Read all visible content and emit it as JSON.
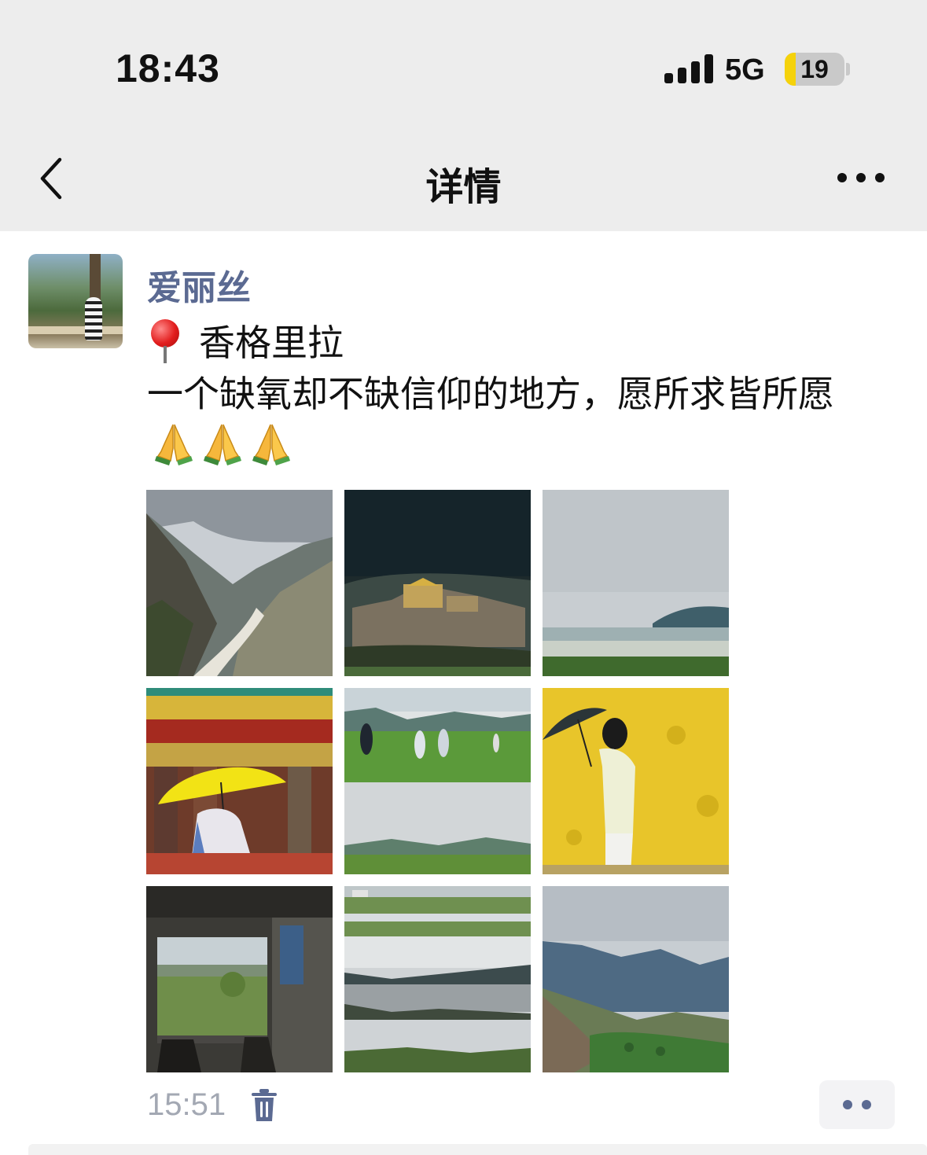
{
  "status_bar": {
    "time": "18:43",
    "network": "5G",
    "battery_level": "19",
    "battery_fraction": 0.19,
    "battery_color": "#f5d20b"
  },
  "nav": {
    "back_icon": "chevron-left-icon",
    "title": "详情",
    "more_icon": "more-horizontal-icon"
  },
  "post": {
    "avatar_icon": "avatar",
    "username": "爱丽丝",
    "location_icon": "round-pushpin-icon",
    "location": "香格里拉",
    "text": "一个缺氧却不缺信仰的地方，愿所求皆所愿",
    "emoji_icons": [
      "folded-hands-icon",
      "folded-hands-icon",
      "folded-hands-icon"
    ],
    "photos": [
      "photo-canyon-river",
      "photo-monastery",
      "photo-lake-grassland",
      "photo-yellow-umbrella-prayer-wheels",
      "photo-grassland-people",
      "photo-yellow-wall-umbrella",
      "photo-window-view",
      "photo-village-lake-collage",
      "photo-mountain-valley"
    ],
    "time": "15:51",
    "delete_icon": "trash-icon",
    "comment_icon": "comment-dots-icon"
  },
  "colors": {
    "username": "#5b6a92",
    "header_bg": "#ededed",
    "timestamp": "#a3a8b3"
  }
}
